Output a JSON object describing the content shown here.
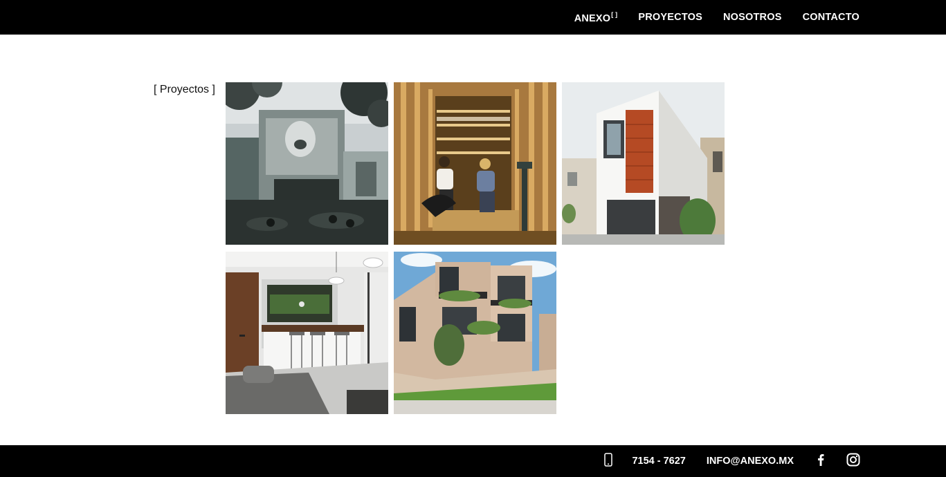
{
  "nav": {
    "brand": "ANEXO",
    "brand_mark": "[ ]",
    "items": [
      "PROYECTOS",
      "NOSOTROS",
      "CONTACTO"
    ]
  },
  "section": {
    "label": "[ Proyectos ]"
  },
  "projects": [
    {
      "thumb": "forest-house-projection"
    },
    {
      "thumb": "wooden-studio-interview"
    },
    {
      "thumb": "white-facade-house"
    },
    {
      "thumb": "interior-tv-bar"
    },
    {
      "thumb": "residential-block-planters"
    }
  ],
  "footer": {
    "phone": "7154 - 7627",
    "email": "INFO@ANEXO.MX",
    "icons": [
      "phone-icon",
      "facebook-icon",
      "instagram-icon"
    ]
  }
}
